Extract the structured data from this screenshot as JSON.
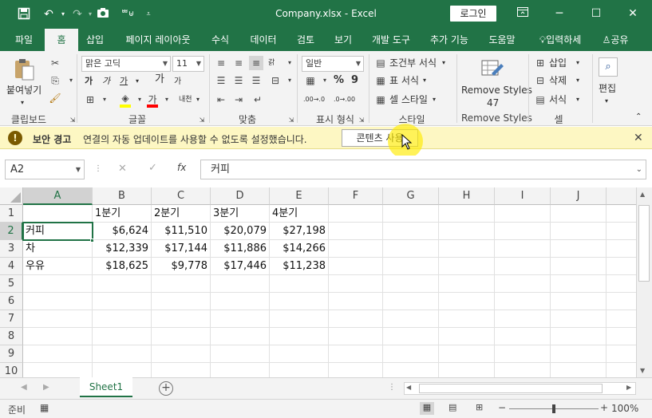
{
  "title_bar": {
    "title": "Company.xlsx  -  Excel",
    "login_label": "로그인",
    "save_icon": "save-icon",
    "undo_icon": "undo-icon",
    "redo_icon": "redo-icon",
    "camera_icon": "camera-icon",
    "qat_extra": "ᄈ⊎"
  },
  "ribbon_tabs": [
    "파일",
    "홈",
    "삽입",
    "페이지 레이아웃",
    "수식",
    "데이터",
    "검토",
    "보기",
    "개발 도구",
    "추가 기능",
    "도움말",
    "입력하세",
    "공유"
  ],
  "active_tab": "홈",
  "ribbon": {
    "clipboard": {
      "paste": "붙여넣기",
      "label": "클립보드"
    },
    "font": {
      "font_name": "맑은 고딕",
      "font_size": "11",
      "bold": "가",
      "italic": "가",
      "underline": "가",
      "grow": "가",
      "shrink": "가",
      "phonetic": "내천",
      "label": "글꼴",
      "fill_color": "#ffff00",
      "font_color": "#ff0000"
    },
    "alignment": {
      "wrap": "갉",
      "label": "맞춤"
    },
    "number": {
      "format": "일반",
      "percent": "%",
      "comma": "9",
      "label": "표시 형식",
      "inc": ".00→.0",
      "dec": ".0→.00"
    },
    "styles": {
      "conditional": "조건부 서식",
      "table": "표 서식",
      "cell": "셀 스타일",
      "label": "스타일"
    },
    "remove_styles": {
      "button_line1": "Remove Styles",
      "button_line2": "47",
      "label": "Remove Styles"
    },
    "cells": {
      "insert": "삽입",
      "delete": "삭제",
      "format": "서식",
      "label": "셀"
    },
    "editing": {
      "label": "편집"
    }
  },
  "security_bar": {
    "title": "보안 경고",
    "message": "연결의 자동 업데이트를 사용할 수 없도록 설정했습니다.",
    "button": "콘텐츠 사용"
  },
  "formula_bar": {
    "name_box": "A2",
    "fx": "fx",
    "content": "커피"
  },
  "columns": [
    "A",
    "B",
    "C",
    "D",
    "E",
    "F",
    "G",
    "H",
    "I",
    "J"
  ],
  "rows": [
    "1",
    "2",
    "3",
    "4",
    "5",
    "6",
    "7",
    "8",
    "9",
    "10"
  ],
  "cells": {
    "r1": [
      "",
      "1분기",
      "2분기",
      "3분기",
      "4분기"
    ],
    "r2": [
      "커피",
      "$6,624",
      "$11,510",
      "$20,079",
      "$27,198"
    ],
    "r3": [
      "차",
      "$12,339",
      "$17,144",
      "$11,886",
      "$14,266"
    ],
    "r4": [
      "우유",
      "$18,625",
      "$9,778",
      "$17,446",
      "$11,238"
    ]
  },
  "selected_cell": "A2",
  "sheet_tab": "Sheet1",
  "status": {
    "ready": "준비",
    "zoom": "100%"
  },
  "colors": {
    "accent": "#217346",
    "warning_bg": "#fdf7c3"
  }
}
